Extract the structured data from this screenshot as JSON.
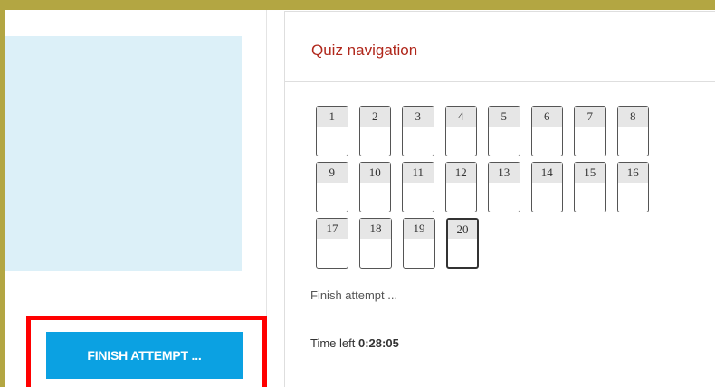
{
  "quiz_navigation": {
    "title": "Quiz navigation",
    "rows": [
      [
        "1",
        "2",
        "3",
        "4",
        "5",
        "6",
        "7",
        "8"
      ],
      [
        "9",
        "10",
        "11",
        "12",
        "13",
        "14",
        "15",
        "16"
      ],
      [
        "17",
        "18",
        "19",
        "20"
      ]
    ],
    "current_question": "20",
    "finish_link": "Finish attempt ...",
    "time_label": "Time left",
    "time_value": "0:28:05"
  },
  "main": {
    "finish_button": "FINISH ATTEMPT ..."
  },
  "colors": {
    "accent": "#0ba1e2",
    "title": "#b0271b",
    "highlight": "#ff0000",
    "info_box": "#dcf0f8"
  }
}
